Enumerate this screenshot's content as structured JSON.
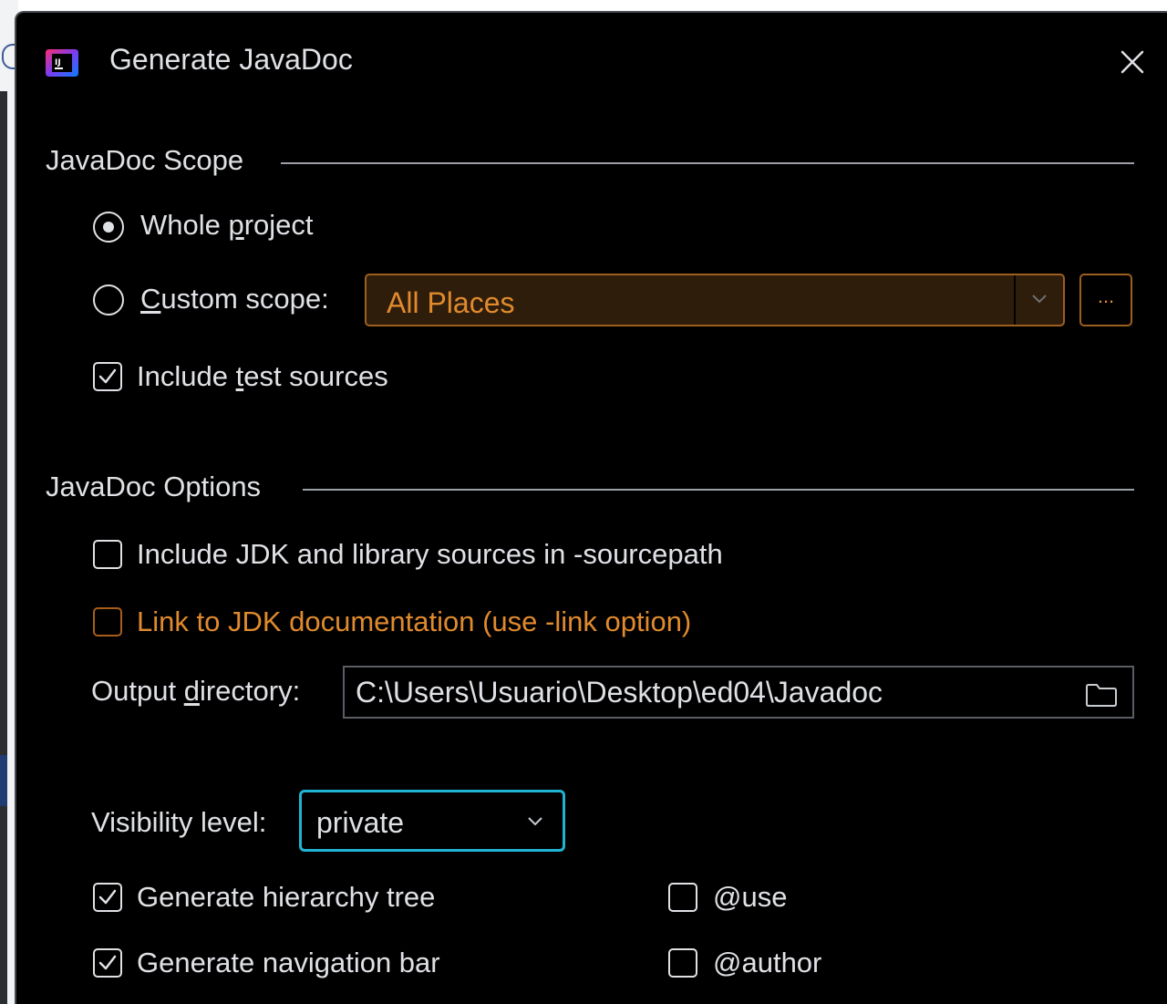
{
  "dialog": {
    "title": "Generate JavaDoc",
    "icons": {
      "app": "intellij-idea-icon",
      "close": "close-icon"
    }
  },
  "scope_section": {
    "title": "JavaDoc Scope",
    "whole_project": {
      "pre": "Whole ",
      "mnemonic": "p",
      "post": "roject",
      "selected": true
    },
    "custom_scope": {
      "pre": "",
      "mnemonic": "C",
      "post": "ustom scope:",
      "selected": false
    },
    "scope_combo": {
      "value": "All Places"
    },
    "ellipsis_label": "...",
    "include_test_sources": {
      "pre": "Include ",
      "mnemonic": "t",
      "post": "est sources",
      "checked": true
    }
  },
  "options_section": {
    "title": "JavaDoc Options",
    "include_jdk_sources": {
      "label": "Include JDK and library sources in -sourcepath",
      "checked": false
    },
    "link_jdk_docs": {
      "label": "Link to JDK documentation (use -link option)",
      "checked": false
    },
    "output_directory": {
      "pre": "Output ",
      "mnemonic": "d",
      "post": "irectory:",
      "value": "C:\\Users\\Usuario\\Desktop\\ed04\\Javadoc"
    },
    "visibility": {
      "label": "Visibility level:",
      "value": "private"
    },
    "generate_hierarchy_tree": {
      "label": "Generate hierarchy tree",
      "checked": true
    },
    "generate_navigation_bar": {
      "label": "Generate navigation bar",
      "checked": true
    },
    "tag_use": {
      "label": "@use",
      "checked": false
    },
    "tag_author": {
      "label": "@author",
      "checked": false
    }
  },
  "colors": {
    "background": "#000000",
    "text": "#dfe1e5",
    "warning_orange": "#e08a2e",
    "focus_cyan": "#1fb4d3"
  }
}
